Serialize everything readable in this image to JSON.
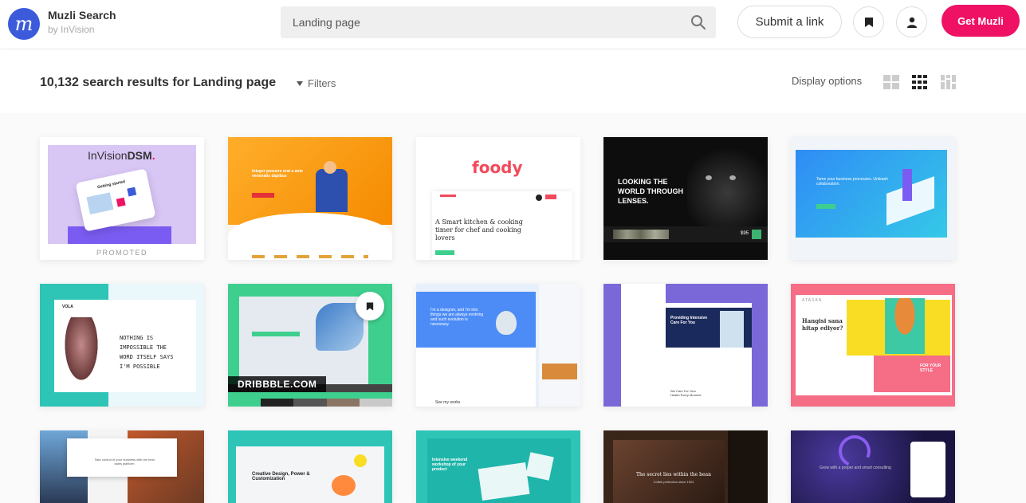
{
  "header": {
    "logo_glyph": "m",
    "brand_name": "Muzli Search",
    "brand_sub": "by InVision",
    "search_value": "Landing page",
    "submit_label": "Submit a link",
    "get_label": "Get Muzli",
    "accent": "#ee1164",
    "logo_color": "#3b5bdb"
  },
  "results": {
    "title": "10,132 search results for Landing page",
    "filters_label": "Filters",
    "display_label": "Display options",
    "display_modes": [
      "grid-large-icon",
      "grid-medium-icon",
      "grid-masonry-icon"
    ],
    "active_mode": "grid-medium-icon"
  },
  "cards": [
    {
      "brand": "InVision",
      "brand2": "DSM",
      "label": "PROMOTED",
      "mini_title": "Getting started"
    },
    {
      "headline": "Integer posuere erat a ante venenatis dapibus"
    },
    {
      "logo": "foody",
      "headline": "A Smart kitchen & cooking timer for chef and cooking lovers"
    },
    {
      "headline": "LOOKING THE WORLD THROUGH LENSES.",
      "price": "$95"
    },
    {
      "headline": "Tame your business processes. Unleash collaboration."
    },
    {
      "brand": "VOLA",
      "headline": "NOTHING IS IMPOSSIBLE THE WORD ITSELF SAYS I'M POSSIBLE"
    },
    {
      "badge": "DRIBBBLE.COM",
      "swatches": [
        "#3ecf8e",
        "#222222",
        "#555555",
        "#8a7565",
        "#c9c9c9"
      ]
    },
    {
      "headline": "I'm a designer, and I'm into things we are always evolving and such evolution is necessary.",
      "footer": "See my works"
    },
    {
      "headline": "Providing Intensive Care For You",
      "sub": "We Care For Your Health Every Moment"
    },
    {
      "brand": "ATASAN",
      "headline": "Hangisi sana hitap ediyor?",
      "badge": "FOR YOUR STYLE"
    },
    {
      "headline": "Take control of your business with the best sales platform"
    },
    {
      "headline": "Creative Design, Power & Customization"
    },
    {
      "headline": "Intensive weekend workshop of your product"
    },
    {
      "headline": "The secret lies within the bean",
      "sub": "Coffee perfection since 1922"
    },
    {
      "headline": "Grow with a proper and smart consulting"
    }
  ]
}
